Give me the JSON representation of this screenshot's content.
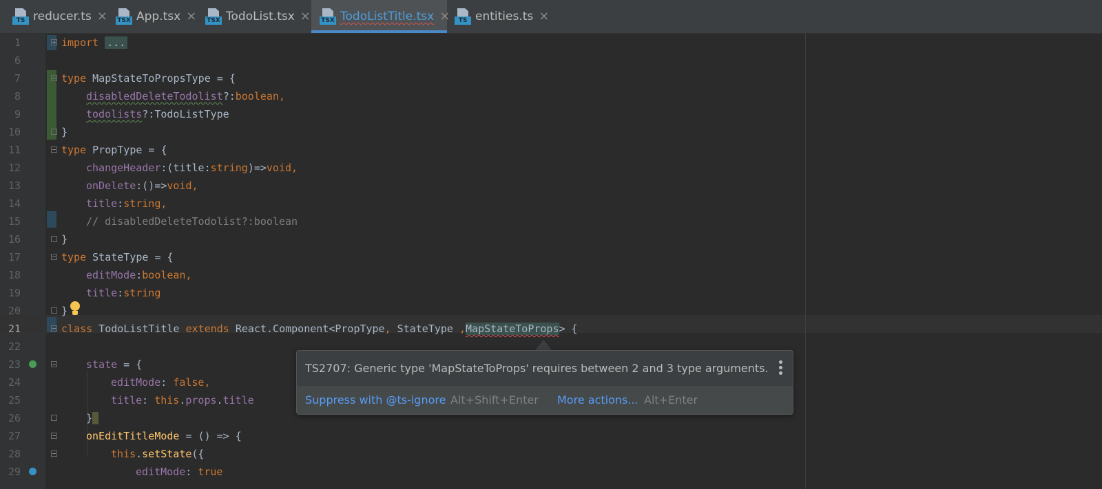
{
  "tabs": [
    {
      "label": "reducer.ts",
      "badge": "TS",
      "active": false
    },
    {
      "label": "App.tsx",
      "badge": "TSX",
      "active": false
    },
    {
      "label": "TodoList.tsx",
      "badge": "TSX",
      "active": false
    },
    {
      "label": "TodoListTitle.tsx",
      "badge": "TSX",
      "active": true
    },
    {
      "label": "entities.ts",
      "badge": "TS",
      "active": false
    }
  ],
  "tab_close_glyph": "×",
  "line_numbers": [
    "1",
    "6",
    "7",
    "8",
    "9",
    "10",
    "11",
    "12",
    "13",
    "14",
    "15",
    "16",
    "17",
    "18",
    "19",
    "20",
    "21",
    "22",
    "23",
    "24",
    "25",
    "26",
    "27",
    "28",
    "29"
  ],
  "code": {
    "l1_kw": "import",
    "l1_fold": "...",
    "l7_kw": "type",
    "l7_rest": " MapStateToPropsType = {",
    "l8_field": "disabledDeleteTodolist",
    "l8_punct": "?:",
    "l8_type": "boolean",
    "l8_comma": ",",
    "l9_field": "todolists",
    "l9_rest": "?:TodoListType",
    "l10": "}",
    "l11_kw": "type",
    "l11_rest": " PropType = {",
    "l12_field": "changeHeader",
    "l12_a": ":(title:",
    "l12_type": "string",
    "l12_b": ")=>",
    "l12_void": "void",
    "l12_comma": ",",
    "l13_field": "onDelete",
    "l13_a": ":()=>",
    "l13_void": "void",
    "l13_comma": ",",
    "l14_field": "title",
    "l14_a": ":",
    "l14_type": "string",
    "l14_comma": ",",
    "l15_comment": "// disabledDeleteTodolist?:boolean",
    "l16": "}",
    "l17_kw": "type",
    "l17_rest": " StateType = {",
    "l18_field": "editMode",
    "l18_a": ":",
    "l18_type": "boolean",
    "l18_comma": ",",
    "l19_field": "title",
    "l19_a": ":",
    "l19_type": "string",
    "l20": "}",
    "l21_kw": "class",
    "l21_name": " TodoListTitle ",
    "l21_extends": "extends",
    "l21_base": " React.Component<PropType",
    "l21_c1": ",",
    "l21_mid": " StateType ",
    "l21_c2": ",",
    "l21_err": "MapStateToProps",
    "l21_end": "> {",
    "l23_field": "state",
    "l23_rest": " = {",
    "l24_field": "editMode",
    "l24_a": ": ",
    "l24_val": "false",
    "l24_comma": ",",
    "l25_field": "title",
    "l25_a": ": ",
    "l25_this": "this",
    "l25_b": ".",
    "l25_props": "props",
    "l25_c": ".",
    "l25_title": "title",
    "l26": "}",
    "l27_fn": "onEditTitleMode",
    "l27_rest": " = () => {",
    "l28_this": "this",
    "l28_a": ".",
    "l28_fn": "setState",
    "l28_b": "({",
    "l29_field": "editMode",
    "l29_a": ": ",
    "l29_val": "true"
  },
  "popup": {
    "message": "TS2707: Generic type 'MapStateToProps' requires between 2 and 3 type arguments.",
    "action1_label": "Suppress with @ts-ignore",
    "action1_shortcut": "Alt+Shift+Enter",
    "action2_label": "More actions...",
    "action2_shortcut": "Alt+Enter"
  },
  "colors": {
    "keyword": "#cc7832",
    "field": "#9876aa",
    "comment": "#808080",
    "function": "#ffc66d",
    "link": "#589df6",
    "error_underline": "#d25252"
  }
}
